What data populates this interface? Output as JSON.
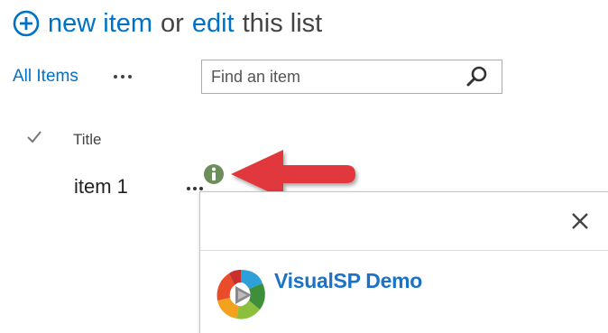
{
  "header": {
    "new_item": "new item",
    "or": "or",
    "edit": "edit",
    "this_list": "this list"
  },
  "toolbar": {
    "view_label": "All Items"
  },
  "search": {
    "placeholder": "Find an item"
  },
  "list": {
    "columns": {
      "title": "Title"
    },
    "rows": [
      {
        "title": "item 1"
      }
    ]
  },
  "callout": {
    "title": "VisualSP Demo"
  },
  "colors": {
    "link_blue": "#0072c6",
    "callout_title": "#1a73c6",
    "annotation_red": "#e0393e",
    "info_green": "#6b8e5a"
  },
  "icons": {
    "header": "plus-circle-icon",
    "search": "search-icon",
    "select_all": "checkmark-icon",
    "row_info": "info-icon",
    "callout_close": "close-icon",
    "callout_logo": "visualsp-logo-icon",
    "annotation": "red-arrow-icon"
  }
}
